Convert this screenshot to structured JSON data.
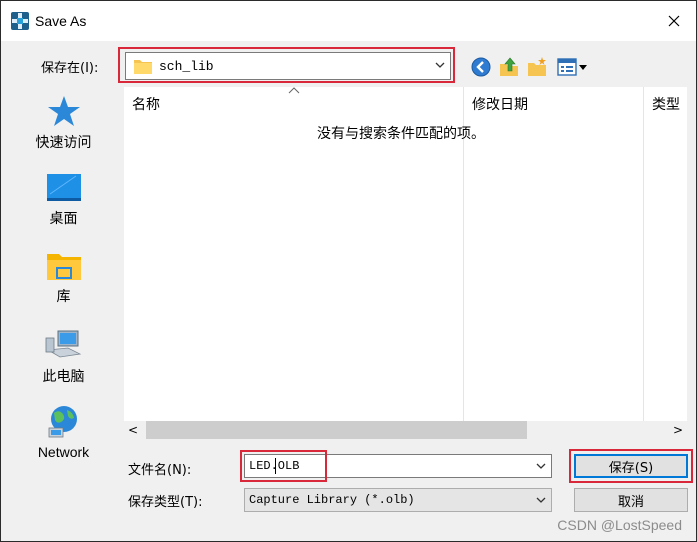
{
  "window": {
    "title": "Save As"
  },
  "look_in": {
    "label": "保存在(I):",
    "value": "sch_lib"
  },
  "places": [
    {
      "label": "快速访问",
      "icon": "star-icon"
    },
    {
      "label": "桌面",
      "icon": "desktop-icon"
    },
    {
      "label": "库",
      "icon": "library-icon"
    },
    {
      "label": "此电脑",
      "icon": "computer-icon"
    },
    {
      "label": "Network",
      "icon": "network-icon"
    }
  ],
  "file_list": {
    "columns": [
      "名称",
      "修改日期",
      "类型"
    ],
    "empty_message": "没有与搜索条件匹配的项。"
  },
  "file_name": {
    "label": "文件名(N):",
    "value": "LED.OLB"
  },
  "file_type": {
    "label": "保存类型(T):",
    "value": "Capture Library (*.olb)"
  },
  "buttons": {
    "save": "保存(S)",
    "cancel": "取消"
  },
  "scroll_arrows": {
    "left": "<",
    "right": ">"
  },
  "watermark": "CSDN @LostSpeed",
  "colors": {
    "highlight": "#d9283a",
    "accent": "#0078d7"
  }
}
